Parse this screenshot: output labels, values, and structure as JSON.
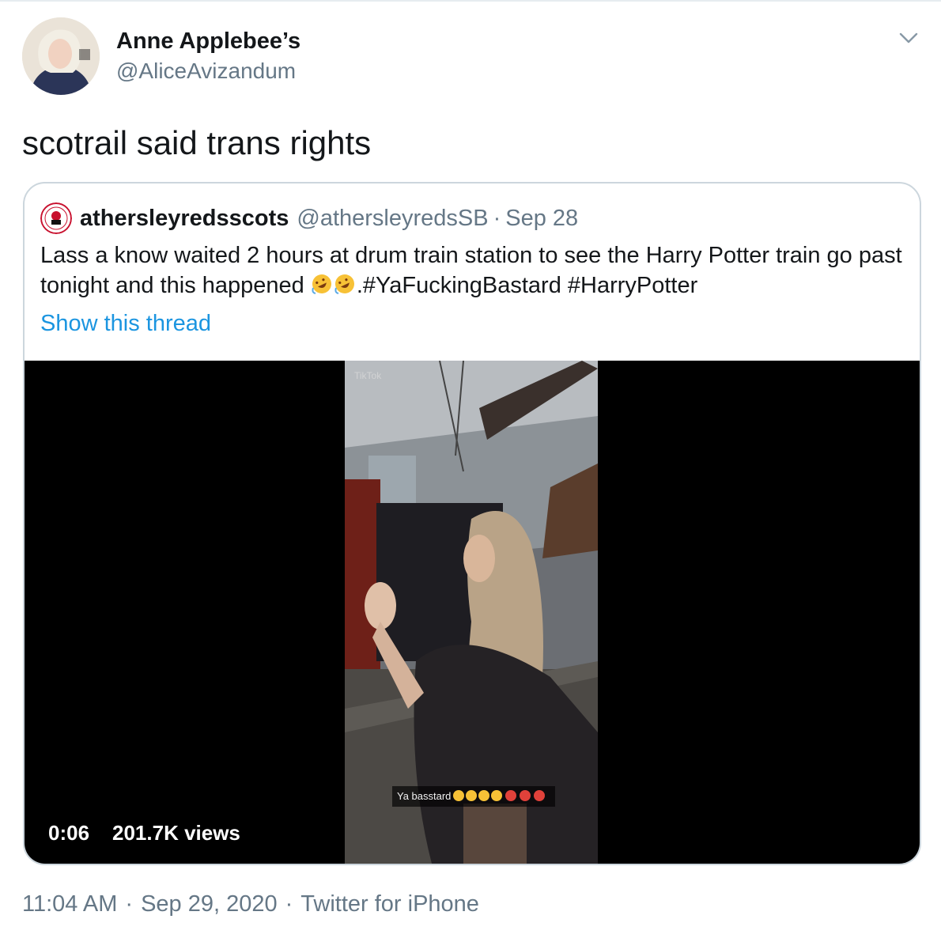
{
  "author": {
    "display_name": "Anne Applebee’s",
    "handle": "@AliceAvizandum"
  },
  "tweet": {
    "text": "scotrail said trans rights"
  },
  "quoted_tweet": {
    "display_name": "athersleyredsscots",
    "handle": "@athersleyredsSB",
    "separator": "·",
    "date": "Sep 28",
    "text_part1": "Lass a know waited 2 hours at drum train station to see the Harry Potter train go past tonight and this happened ",
    "text_part2": ".#YaFuckingBastard #HarryPotter",
    "show_thread_label": "Show this thread",
    "video": {
      "tiktok_watermark": "TikTok",
      "caption": "Ya basstard",
      "duration": "0:06",
      "views": "201.7K views"
    }
  },
  "meta": {
    "time": "11:04 AM",
    "separator": "·",
    "date": "Sep 29, 2020",
    "source": "Twitter for iPhone"
  },
  "icons": {
    "caret": "chevron-down-icon",
    "emoji": "rolling-on-floor-laughing-emoji"
  },
  "colors": {
    "link": "#1b95e0",
    "secondary_text": "#657786",
    "border": "#ccd6dd"
  }
}
